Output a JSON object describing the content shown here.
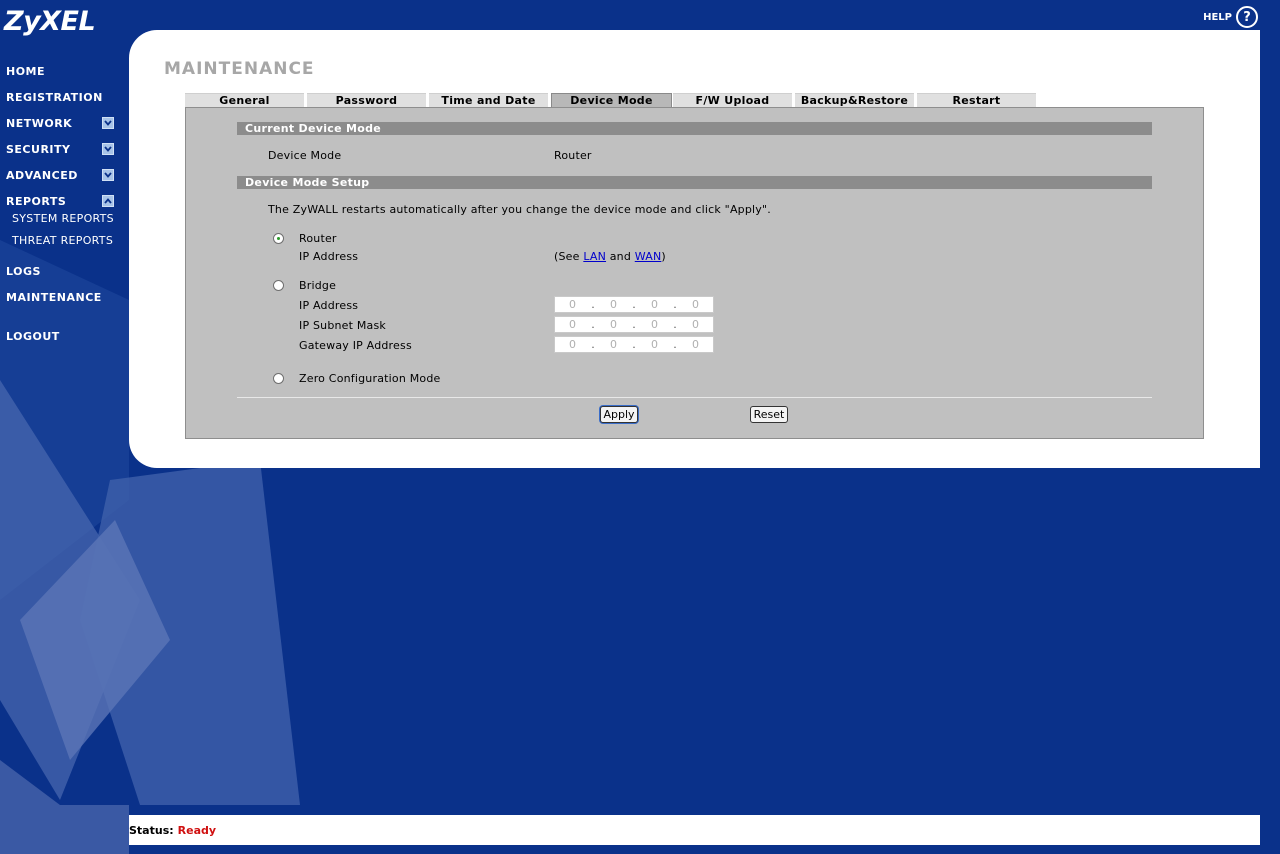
{
  "brand": {
    "logo": "ZyXEL",
    "help_label": "HELP",
    "help_glyph": "?"
  },
  "nav": {
    "items": [
      {
        "label": "HOME"
      },
      {
        "label": "REGISTRATION"
      },
      {
        "label": "NETWORK"
      },
      {
        "label": "SECURITY"
      },
      {
        "label": "ADVANCED"
      },
      {
        "label": "REPORTS"
      },
      {
        "label": "LOGS"
      },
      {
        "label": "MAINTENANCE"
      },
      {
        "label": "LOGOUT"
      }
    ],
    "sub_items": [
      {
        "label": "SYSTEM REPORTS"
      },
      {
        "label": "THREAT REPORTS"
      }
    ]
  },
  "page": {
    "title": "MAINTENANCE"
  },
  "tabs": [
    {
      "label": "General"
    },
    {
      "label": "Password"
    },
    {
      "label": "Time and Date"
    },
    {
      "label": "Device Mode",
      "active": true
    },
    {
      "label": "F/W Upload"
    },
    {
      "label": "Backup&Restore"
    },
    {
      "label": "Restart"
    }
  ],
  "current": {
    "header": "Current Device Mode",
    "label": "Device Mode",
    "value": "Router"
  },
  "setup": {
    "header": "Device Mode Setup",
    "note": "The ZyWALL restarts automatically after you change the device mode and click \"Apply\".",
    "router": {
      "label": "Router",
      "ip_label": "IP Address",
      "see_prefix": "(See ",
      "lan_link": "LAN",
      "and_text": " and ",
      "wan_link": "WAN",
      "see_suffix": ")"
    },
    "bridge": {
      "label": "Bridge",
      "ip_label": "IP Address",
      "mask_label": "IP Subnet Mask",
      "gateway_label": "Gateway IP Address",
      "ip": [
        "0",
        "0",
        "0",
        "0"
      ],
      "mask": [
        "0",
        "0",
        "0",
        "0"
      ],
      "gateway": [
        "0",
        "0",
        "0",
        "0"
      ],
      "dot": "."
    },
    "zero": {
      "label": "Zero Configuration Mode"
    },
    "selected": "router"
  },
  "buttons": {
    "apply": "Apply",
    "reset": "Reset"
  },
  "status": {
    "label": "Status:",
    "value": "Ready"
  },
  "colors": {
    "background": "#0a318a",
    "status_ok": "#d01010",
    "section_bar": "#8c8c8c"
  }
}
